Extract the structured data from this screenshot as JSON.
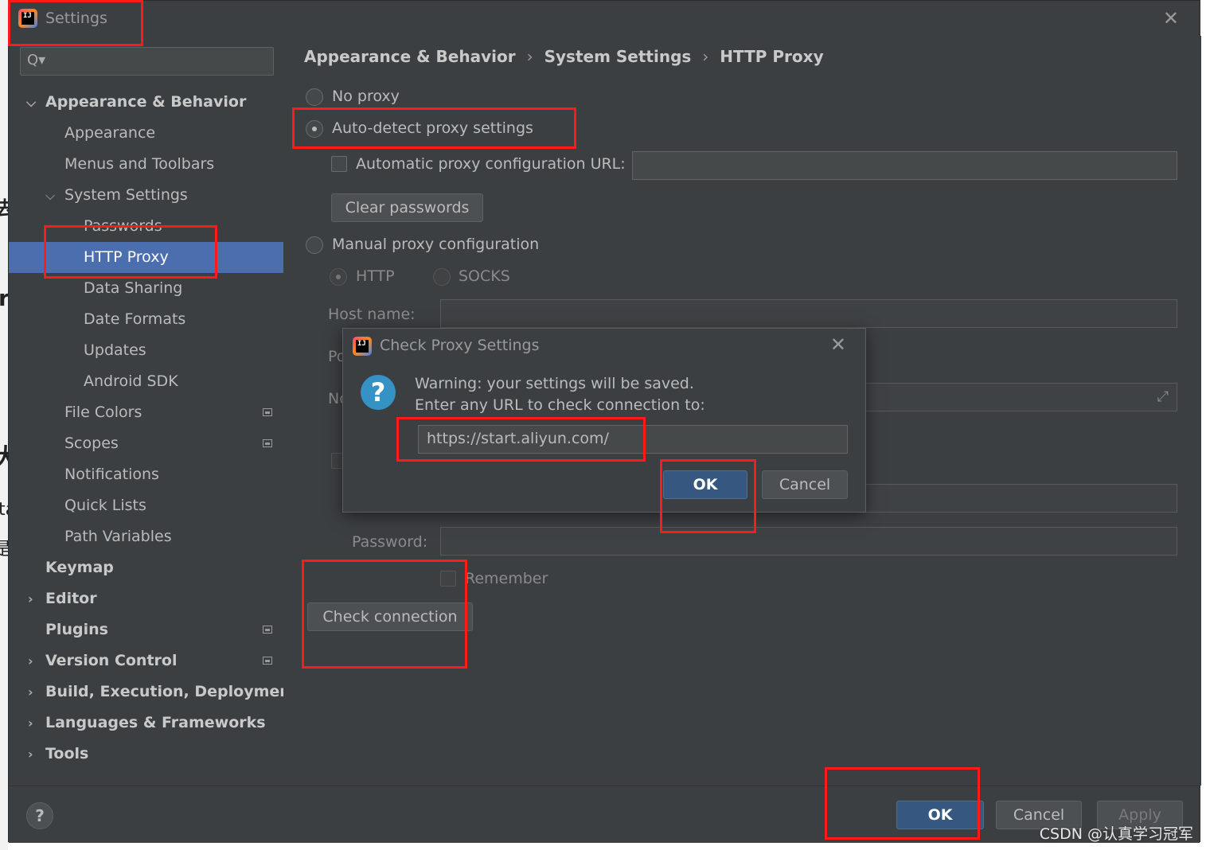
{
  "window": {
    "title": "Settings",
    "close_glyph": "✕"
  },
  "search": {
    "placeholder": "",
    "icon": "Q▾"
  },
  "sidebar": {
    "items": [
      {
        "label": "Appearance & Behavior",
        "level": 0,
        "bold": true,
        "expanded": true
      },
      {
        "label": "Appearance",
        "level": 1
      },
      {
        "label": "Menus and Toolbars",
        "level": 1
      },
      {
        "label": "System Settings",
        "level": 1,
        "expanded": true
      },
      {
        "label": "Passwords",
        "level": 2
      },
      {
        "label": "HTTP Proxy",
        "level": 2,
        "selected": true
      },
      {
        "label": "Data Sharing",
        "level": 2
      },
      {
        "label": "Date Formats",
        "level": 2
      },
      {
        "label": "Updates",
        "level": 2
      },
      {
        "label": "Android SDK",
        "level": 2
      },
      {
        "label": "File Colors",
        "level": 1,
        "badge": true
      },
      {
        "label": "Scopes",
        "level": 1,
        "badge": true
      },
      {
        "label": "Notifications",
        "level": 1
      },
      {
        "label": "Quick Lists",
        "level": 1
      },
      {
        "label": "Path Variables",
        "level": 1
      },
      {
        "label": "Keymap",
        "level": 0,
        "bold": true
      },
      {
        "label": "Editor",
        "level": 0,
        "bold": true,
        "collapsed": true
      },
      {
        "label": "Plugins",
        "level": 0,
        "bold": true,
        "badge": true
      },
      {
        "label": "Version Control",
        "level": 0,
        "bold": true,
        "collapsed": true,
        "badge": true
      },
      {
        "label": "Build, Execution, Deployment",
        "level": 0,
        "bold": true,
        "collapsed": true
      },
      {
        "label": "Languages & Frameworks",
        "level": 0,
        "bold": true,
        "collapsed": true
      },
      {
        "label": "Tools",
        "level": 0,
        "bold": true,
        "collapsed": true
      }
    ]
  },
  "breadcrumb": [
    "Appearance & Behavior",
    "System Settings",
    "HTTP Proxy"
  ],
  "breadcrumb_sep": "›",
  "proxy": {
    "no_proxy": "No proxy",
    "auto_detect": "Auto-detect proxy settings",
    "auto_config_url_label": "Automatic proxy configuration URL:",
    "auto_config_url_value": "",
    "clear_passwords": "Clear passwords",
    "manual": "Manual proxy configuration",
    "http": "HTTP",
    "socks": "SOCKS",
    "host_name": "Host name:",
    "port_partial": "Po",
    "no_proxy_partial": "No",
    "password": "Password:",
    "remember": "Remember",
    "check_connection": "Check connection",
    "selected": "auto_detect"
  },
  "dialog": {
    "title": "Check Proxy Settings",
    "close_glyph": "✕",
    "icon": "?",
    "line1": "Warning: your settings will be saved.",
    "line2": "Enter any URL to check connection to:",
    "url_value": "https://start.aliyun.com/",
    "ok": "OK",
    "cancel": "Cancel"
  },
  "footer": {
    "help": "?",
    "ok": "OK",
    "cancel": "Cancel",
    "apply": "Apply"
  },
  "background_fragments": [
    "去",
    "r",
    "大",
    "ta",
    "是"
  ],
  "watermark": "CSDN @认真学习冠军",
  "colors": {
    "selection": "#4b6eaf",
    "primary_button": "#365880",
    "annotation_red": "#ff1a1a",
    "help_icon_blue": "#3592c4"
  }
}
